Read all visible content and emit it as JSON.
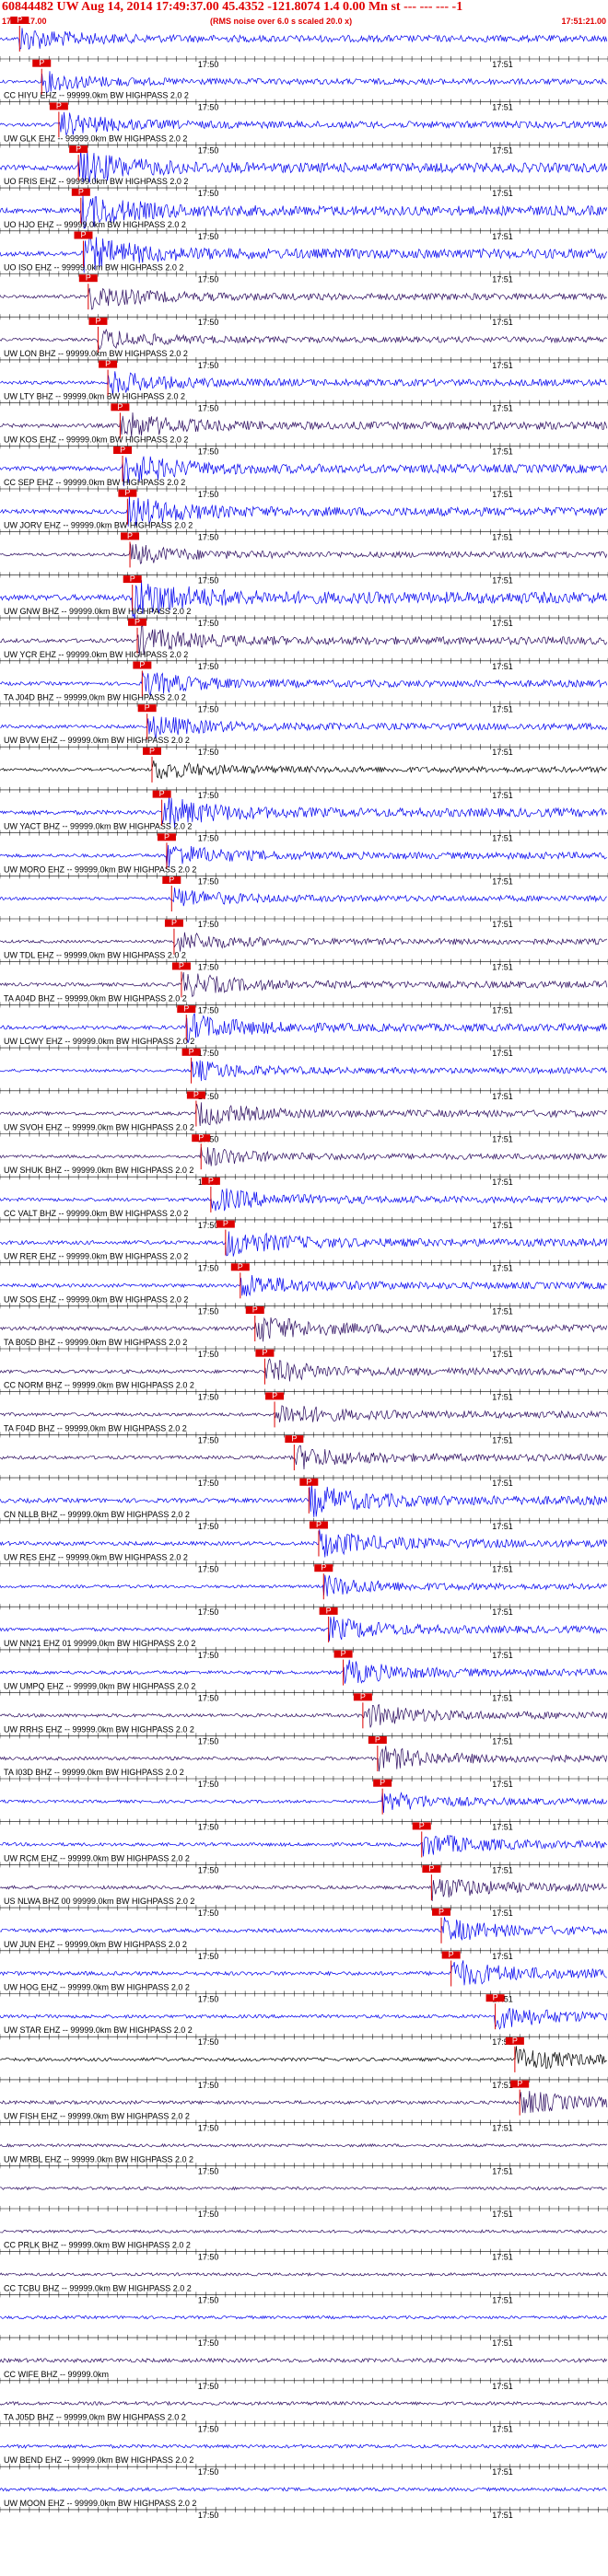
{
  "header": {
    "title": "60844482 UW Aug 14, 2014 17:49:37.00   45.4352 -121.8074  1.4 0.00 Mn st --- --- ---  -1",
    "start_time": "17:49:17.00",
    "end_time": "17:51:21.00",
    "note": "(RMS noise over 6.0 s scaled 20.0 x)"
  },
  "chart_data": {
    "type": "line",
    "title": "60844482 UW Aug 14, 2014 17:49:37.00   45.4352 -121.8074  1.4 0.00 Mn st --- --- ---  -1",
    "x_unit": "seconds after 17:49:17.00",
    "xlim": [
      0,
      124
    ],
    "time_ticks": [
      "17:50",
      "17:51"
    ],
    "pick_marker_label": "P",
    "colors": {
      "blue": "#0000ee",
      "purple": "#2a0a5e",
      "black": "#000000",
      "pick": "#dd0000"
    },
    "traces": [
      {
        "label": "",
        "color": "blue",
        "pick_time": 4.0,
        "amplitude": 0.35
      },
      {
        "label": "CC HIYU EHZ -- 99999.0km BW  HIGHPASS  2.0  2",
        "color": "blue",
        "pick_time": 8.5,
        "amplitude": 0.3
      },
      {
        "label": "UW GLK EHZ -- 99999.0km BW  HIGHPASS  2.0  2",
        "color": "blue",
        "pick_time": 12.0,
        "amplitude": 0.35
      },
      {
        "label": "UO FRIS EHZ -- 99999.0km BW  HIGHPASS  2.0  2",
        "color": "blue",
        "pick_time": 16.0,
        "amplitude": 0.5
      },
      {
        "label": "UO HJO EHZ -- 99999.0km BW  HIGHPASS  2.0  2",
        "color": "blue",
        "pick_time": 16.5,
        "amplitude": 0.5
      },
      {
        "label": "UO ISO EHZ -- 99999.0km BW  HIGHPASS  2.0  2",
        "color": "blue",
        "pick_time": 17.0,
        "amplitude": 0.5
      },
      {
        "label": "",
        "color": "purple",
        "pick_time": 18.0,
        "amplitude": 0.35
      },
      {
        "label": "UW LON BHZ -- 99999.0km BW  HIGHPASS  2.0  2",
        "color": "purple",
        "pick_time": 20.0,
        "amplitude": 0.3
      },
      {
        "label": "UW LTY BHZ -- 99999.0km BW  HIGHPASS  2.0  2",
        "color": "blue",
        "pick_time": 22.0,
        "amplitude": 0.35
      },
      {
        "label": "UW KOS EHZ -- 99999.0km BW  HIGHPASS  2.0  2",
        "color": "purple",
        "pick_time": 24.5,
        "amplitude": 0.4
      },
      {
        "label": "CC SEP EHZ -- 99999.0km BW  HIGHPASS  2.0  2",
        "color": "blue",
        "pick_time": 25.0,
        "amplitude": 0.45
      },
      {
        "label": "UW JORV EHZ -- 99999.0km BW  HIGHPASS  2.0  2",
        "color": "blue",
        "pick_time": 26.0,
        "amplitude": 0.45
      },
      {
        "label": "",
        "color": "purple",
        "pick_time": 26.5,
        "amplitude": 0.3
      },
      {
        "label": "UW GNW BHZ -- 99999.0km BW  HIGHPASS  2.0  2",
        "color": "blue",
        "pick_time": 27.0,
        "amplitude": 0.6
      },
      {
        "label": "UW YCR EHZ -- 99999.0km BW  HIGHPASS  2.0  2",
        "color": "purple",
        "pick_time": 28.0,
        "amplitude": 0.4
      },
      {
        "label": "TA J04D BHZ -- 99999.0km BW  HIGHPASS  2.0  2",
        "color": "blue",
        "pick_time": 29.0,
        "amplitude": 0.35
      },
      {
        "label": "UW BVW EHZ -- 99999.0km BW  HIGHPASS  2.0  2",
        "color": "blue",
        "pick_time": 30.0,
        "amplitude": 0.35
      },
      {
        "label": "",
        "color": "black",
        "pick_time": 31.0,
        "amplitude": 0.3
      },
      {
        "label": "UW YACT BHZ -- 99999.0km BW  HIGHPASS  2.0  2",
        "color": "blue",
        "pick_time": 33.0,
        "amplitude": 0.45
      },
      {
        "label": "UW MORO EHZ -- 99999.0km BW  HIGHPASS  2.0  2",
        "color": "blue",
        "pick_time": 34.0,
        "amplitude": 0.35
      },
      {
        "label": "",
        "color": "blue",
        "pick_time": 35.0,
        "amplitude": 0.3
      },
      {
        "label": "UW TDL EHZ -- 99999.0km BW  HIGHPASS  2.0  2",
        "color": "purple",
        "pick_time": 35.5,
        "amplitude": 0.3
      },
      {
        "label": "TA A04D BHZ -- 99999.0km BW  HIGHPASS  2.0  2",
        "color": "purple",
        "pick_time": 37.0,
        "amplitude": 0.35
      },
      {
        "label": "UW LCWY EHZ -- 99999.0km BW  HIGHPASS  2.0  2",
        "color": "blue",
        "pick_time": 38.0,
        "amplitude": 0.4
      },
      {
        "label": "",
        "color": "blue",
        "pick_time": 39.0,
        "amplitude": 0.3
      },
      {
        "label": "UW SVOH EHZ -- 99999.0km BW  HIGHPASS  2.0  2",
        "color": "purple",
        "pick_time": 40.0,
        "amplitude": 0.35
      },
      {
        "label": "UW SHUK BHZ -- 99999.0km BW  HIGHPASS  2.0  2",
        "color": "purple",
        "pick_time": 41.0,
        "amplitude": 0.3
      },
      {
        "label": "CC VALT BHZ -- 99999.0km BW  HIGHPASS  2.0  2",
        "color": "blue",
        "pick_time": 43.0,
        "amplitude": 0.35
      },
      {
        "label": "UW RER EHZ -- 99999.0km BW  HIGHPASS  2.0  2",
        "color": "blue",
        "pick_time": 46.0,
        "amplitude": 0.4
      },
      {
        "label": "UW SOS EHZ -- 99999.0km BW  HIGHPASS  2.0  2",
        "color": "blue",
        "pick_time": 49.0,
        "amplitude": 0.35
      },
      {
        "label": "TA B05D BHZ -- 99999.0km BW  HIGHPASS  2.0  2",
        "color": "purple",
        "pick_time": 52.0,
        "amplitude": 0.4
      },
      {
        "label": "CC NORM BHZ -- 99999.0km BW  HIGHPASS  2.0  2",
        "color": "purple",
        "pick_time": 54.0,
        "amplitude": 0.35
      },
      {
        "label": "TA F04D BHZ -- 99999.0km BW  HIGHPASS  2.0  2",
        "color": "purple",
        "pick_time": 56.0,
        "amplitude": 0.35
      },
      {
        "label": "",
        "color": "purple",
        "pick_time": 60.0,
        "amplitude": 0.35
      },
      {
        "label": "CN NLLB BHZ -- 99999.0km BW  HIGHPASS  2.0  2",
        "color": "blue",
        "pick_time": 63.0,
        "amplitude": 0.45
      },
      {
        "label": "UW RES EHZ -- 99999.0km BW  HIGHPASS  2.0  2",
        "color": "blue",
        "pick_time": 65.0,
        "amplitude": 0.4
      },
      {
        "label": "",
        "color": "blue",
        "pick_time": 66.0,
        "amplitude": 0.3
      },
      {
        "label": "UW NN21 EHZ 01 99999.0km BW  HIGHPASS  2.0  2",
        "color": "blue",
        "pick_time": 67.0,
        "amplitude": 0.35
      },
      {
        "label": "UW UMPQ EHZ -- 99999.0km BW  HIGHPASS  2.0  2",
        "color": "blue",
        "pick_time": 70.0,
        "amplitude": 0.35
      },
      {
        "label": "UW RRHS EHZ -- 99999.0km BW  HIGHPASS  2.0  2",
        "color": "purple",
        "pick_time": 74.0,
        "amplitude": 0.35
      },
      {
        "label": "TA I03D BHZ -- 99999.0km BW  HIGHPASS  2.0  2",
        "color": "purple",
        "pick_time": 77.0,
        "amplitude": 0.35
      },
      {
        "label": "",
        "color": "blue",
        "pick_time": 78.0,
        "amplitude": 0.3
      },
      {
        "label": "UW RCM EHZ -- 99999.0km BW  HIGHPASS  2.0  2",
        "color": "blue",
        "pick_time": 86.0,
        "amplitude": 0.35
      },
      {
        "label": "US NLWA BHZ 00 99999.0km BW  HIGHPASS  2.0  2",
        "color": "purple",
        "pick_time": 88.0,
        "amplitude": 0.35
      },
      {
        "label": "UW JUN EHZ -- 99999.0km BW  HIGHPASS  2.0  2",
        "color": "blue",
        "pick_time": 90.0,
        "amplitude": 0.35
      },
      {
        "label": "UW HOG EHZ -- 99999.0km BW  HIGHPASS  2.0  2",
        "color": "blue",
        "pick_time": 92.0,
        "amplitude": 0.4
      },
      {
        "label": "UW STAR EHZ -- 99999.0km BW  HIGHPASS  2.0  2",
        "color": "blue",
        "pick_time": 101.0,
        "amplitude": 0.35
      },
      {
        "label": "",
        "color": "black",
        "pick_time": 105.0,
        "amplitude": 0.35
      },
      {
        "label": "UW FISH EHZ -- 99999.0km BW  HIGHPASS  2.0  2",
        "color": "purple",
        "pick_time": 106.0,
        "amplitude": 0.35
      },
      {
        "label": "UW MRBL EHZ -- 99999.0km BW  HIGHPASS  2.0  2",
        "color": "purple",
        "pick_time": null,
        "amplitude": 0.3
      },
      {
        "label": "",
        "color": "purple",
        "pick_time": null,
        "amplitude": 0.3
      },
      {
        "label": "CC PRLK BHZ -- 99999.0km BW  HIGHPASS  2.0  2",
        "color": "purple",
        "pick_time": null,
        "amplitude": 0.3
      },
      {
        "label": "CC TCBU BHZ -- 99999.0km BW  HIGHPASS  2.0  2",
        "color": "purple",
        "pick_time": null,
        "amplitude": 0.3
      },
      {
        "label": "",
        "color": "blue",
        "pick_time": null,
        "amplitude": 0.3
      },
      {
        "label": "CC WIFE BHZ -- 99999.0km",
        "color": "purple",
        "pick_time": null,
        "amplitude": 0.4
      },
      {
        "label": "TA J05D BHZ -- 99999.0km BW  HIGHPASS  2.0  2",
        "color": "purple",
        "pick_time": null,
        "amplitude": 0.35
      },
      {
        "label": "UW BEND EHZ -- 99999.0km BW  HIGHPASS  2.0  2",
        "color": "blue",
        "pick_time": null,
        "amplitude": 0.35
      },
      {
        "label": "UW MOON EHZ -- 99999.0km BW  HIGHPASS  2.0  2",
        "color": "blue",
        "pick_time": null,
        "amplitude": 0.35
      }
    ]
  }
}
